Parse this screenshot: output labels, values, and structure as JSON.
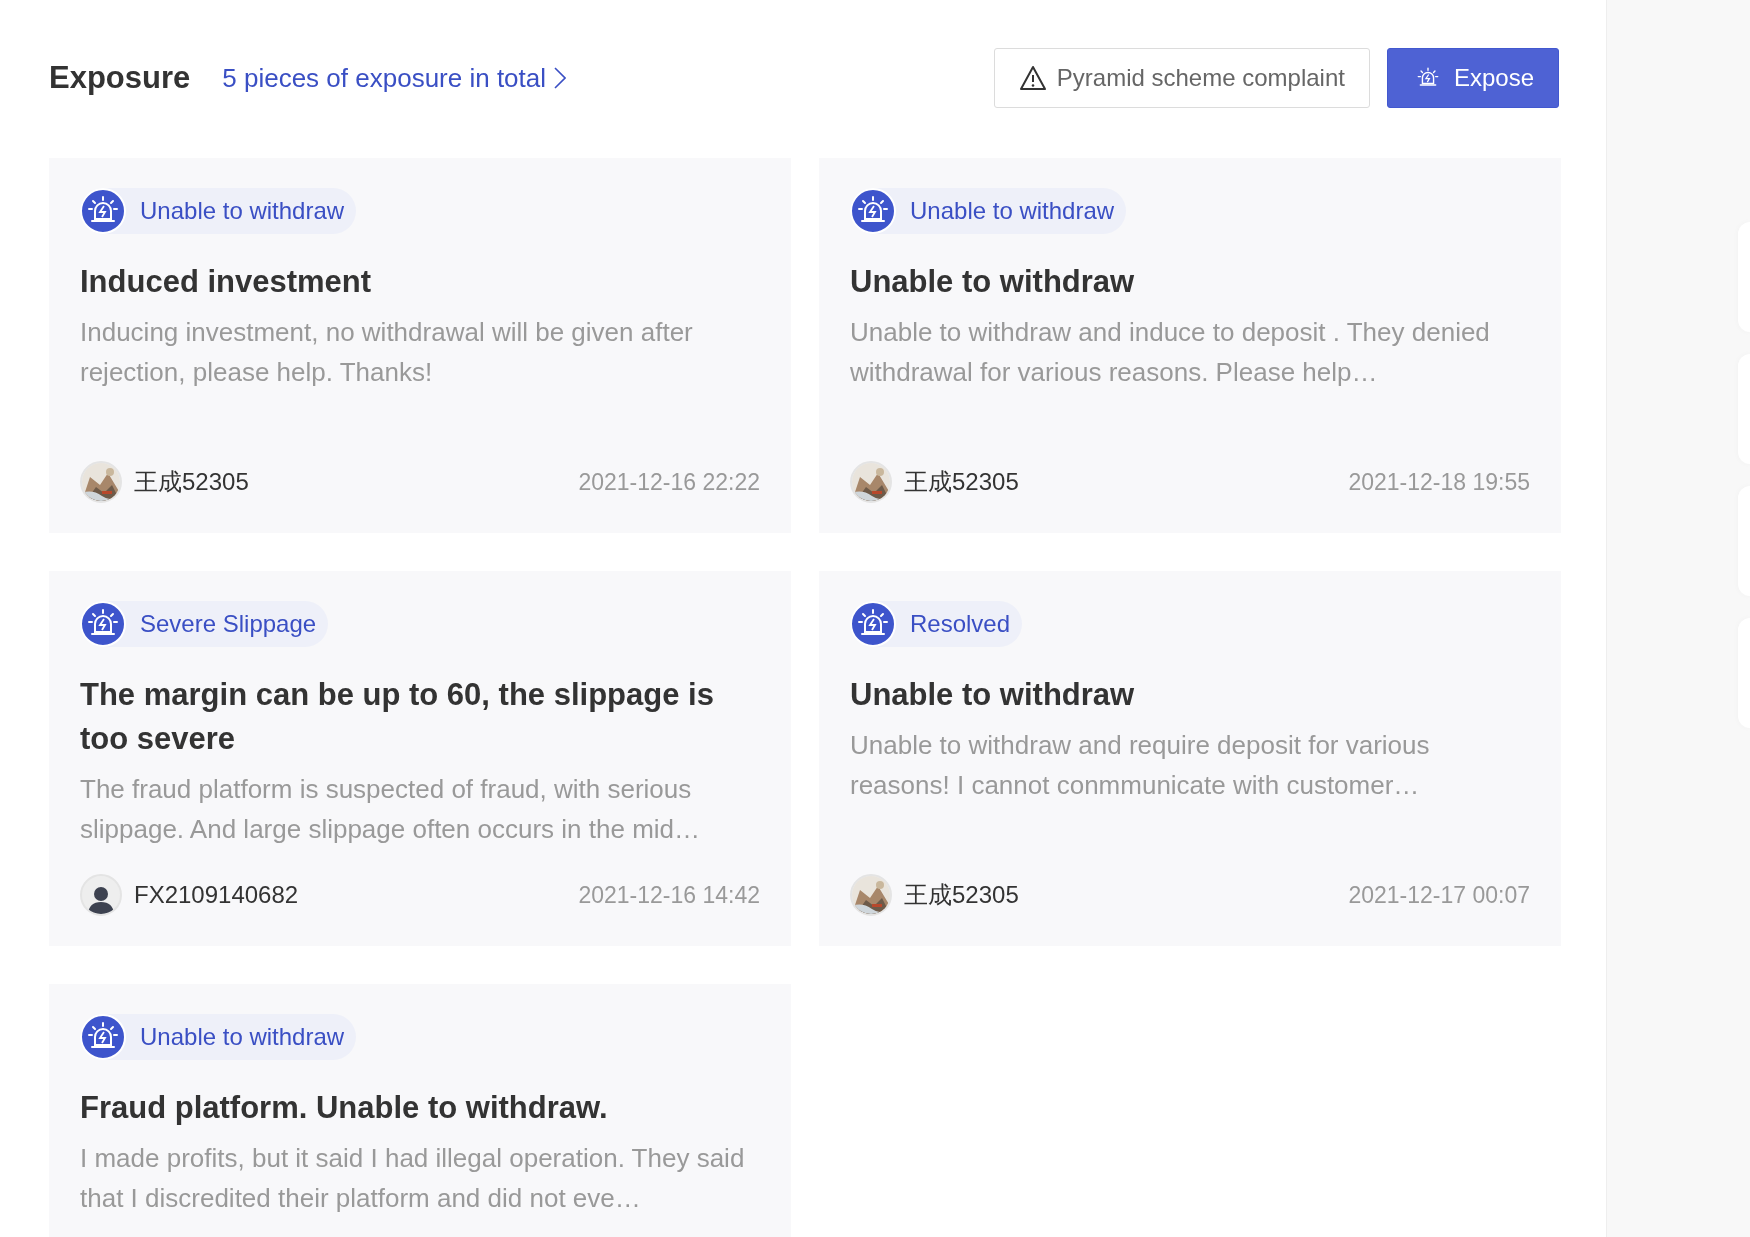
{
  "header": {
    "title": "Exposure",
    "summary_link": "5 pieces of exposure in total",
    "buttons": [
      {
        "kind": "outline",
        "label": "Pyramid scheme complaint"
      },
      {
        "kind": "primary",
        "label": "Expose"
      }
    ]
  },
  "cards": [
    {
      "tag": "Unable to withdraw",
      "title": "Induced investment",
      "description": "Inducing investment, no withdrawal will be given after rejection, please help. Thanks!",
      "author": "王成52305",
      "date": "2021-12-16 22:22"
    },
    {
      "tag": "Unable to withdraw",
      "title": "Unable to withdraw",
      "description": "Unable to withdraw and induce to deposit . They denied withdrawal for various reasons. Please help…",
      "author": "王成52305",
      "date": "2021-12-18 19:55"
    },
    {
      "tag": "Severe Slippage",
      "title": "The margin can be up to 60, the slippage is too severe",
      "description": "The fraud platform is suspected of fraud, with serious slippage. And large slippage often occurs in the mid…",
      "author": "FX2109140682",
      "avatar": {
        "kind": "default"
      },
      "date": "2021-12-16 14:42"
    },
    {
      "tag": "Resolved",
      "title": "Unable to withdraw",
      "description": "Unable to withdraw and require deposit for various reasons! I cannot conmmunicate with customer…",
      "author": "王成52305",
      "date": "2021-12-17 00:07"
    },
    {
      "tag": "Unable to withdraw",
      "title": "Fraud platform. Unable to withdraw.",
      "description": "I made profits, but it said I had illegal operation. They said that I discredited their platform and did not eve…"
    }
  ]
}
